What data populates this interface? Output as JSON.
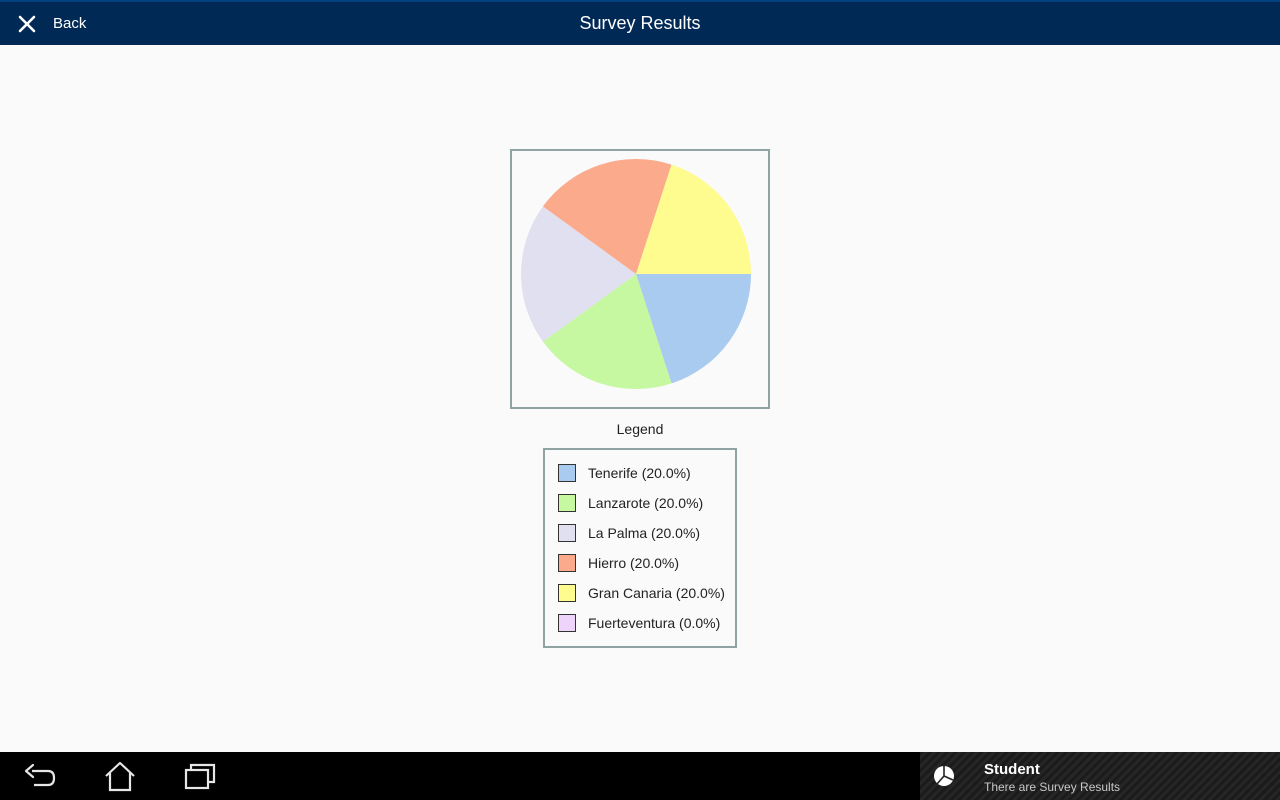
{
  "app_bar": {
    "back_label": "Back",
    "title": "Survey Results"
  },
  "legend": {
    "title": "Legend"
  },
  "chart_data": {
    "type": "pie",
    "title": "",
    "slices": [
      {
        "label": "Tenerife (20.0%)",
        "name": "Tenerife",
        "value": 20.0,
        "color": "#a8cbef"
      },
      {
        "label": "Lanzarote (20.0%)",
        "name": "Lanzarote",
        "value": 20.0,
        "color": "#c6f7a1"
      },
      {
        "label": "La Palma (20.0%)",
        "name": "La Palma",
        "value": 20.0,
        "color": "#e1e0f0"
      },
      {
        "label": "Hierro (20.0%)",
        "name": "Hierro",
        "value": 20.0,
        "color": "#fbaa8c"
      },
      {
        "label": "Gran Canaria (20.0%)",
        "name": "Gran Canaria",
        "value": 20.0,
        "color": "#fefc8f"
      },
      {
        "label": "Fuerteventura (0.0%)",
        "name": "Fuerteventura",
        "value": 0.0,
        "color": "#eed4fb"
      }
    ]
  },
  "notification": {
    "title": "Student",
    "text": "There are Survey Results"
  },
  "icons": {
    "close": "close-icon",
    "back": "back-arrow-icon",
    "home": "home-icon",
    "recents": "recent-apps-icon",
    "notification": "pie-chart-icon"
  },
  "colors": {
    "app_bar": "#002a55",
    "frame_border": "#8fa3a2",
    "nav_bar": "#000000"
  }
}
